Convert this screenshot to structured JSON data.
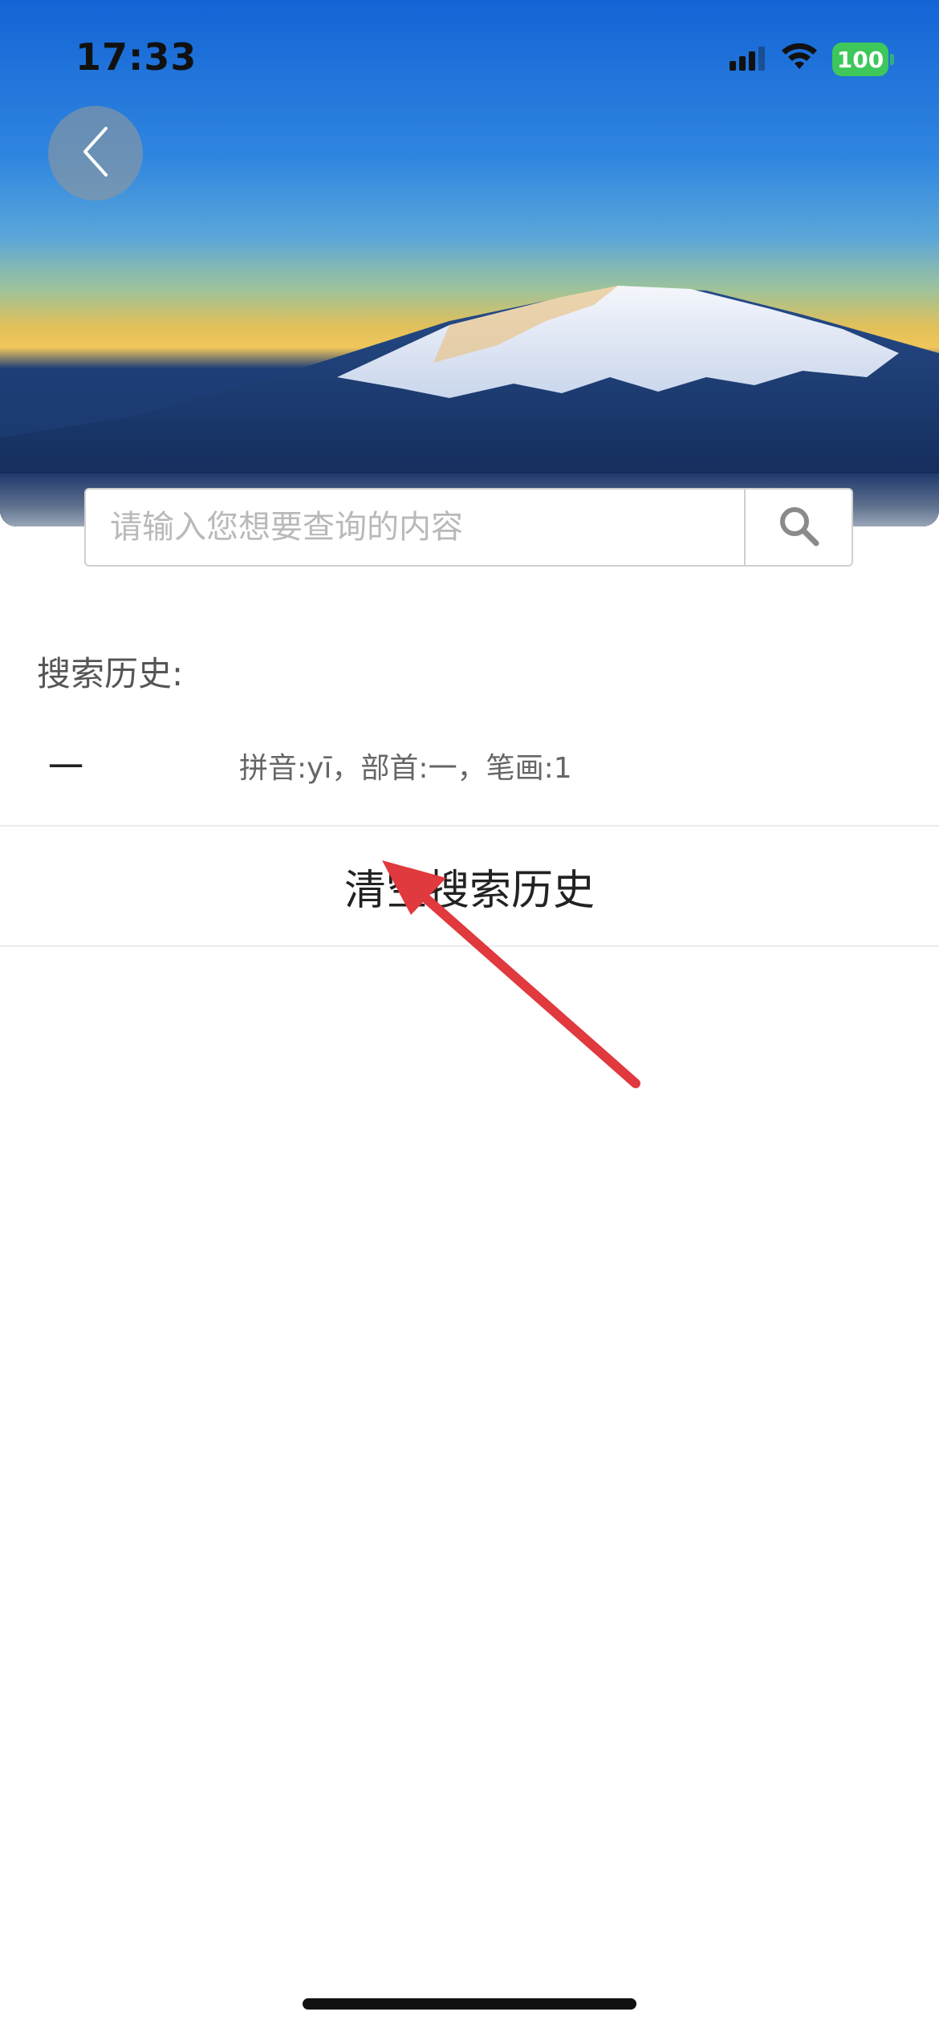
{
  "status_bar": {
    "time": "17:33",
    "battery": "100",
    "icons": [
      "cellular-signal-icon",
      "wifi-icon",
      "battery-icon"
    ]
  },
  "header": {
    "back_icon": "chevron-left-icon"
  },
  "search": {
    "placeholder": "请输入您想要查询的内容",
    "value": "",
    "button_icon": "search-icon"
  },
  "history": {
    "title": "搜索历史:",
    "items": [
      {
        "character": "一",
        "description": "拼音:yī，部首:一，笔画:1"
      }
    ],
    "clear_label": "清空搜索历史"
  },
  "colors": {
    "battery": "#3ec75a",
    "annotation_arrow": "#e0393e",
    "placeholder": "#b9b9b9"
  }
}
